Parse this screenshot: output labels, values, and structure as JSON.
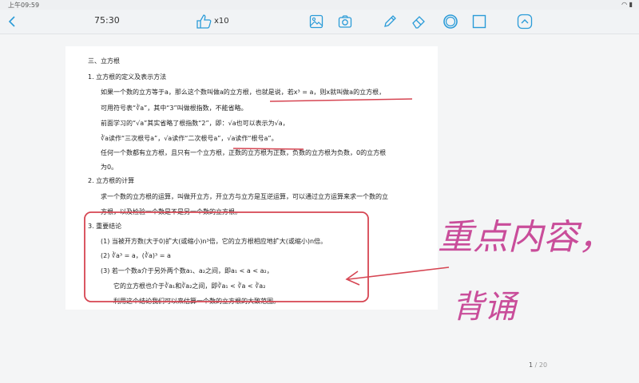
{
  "status": {
    "time": "上午09:59"
  },
  "toolbar": {
    "timer": "75:30",
    "likes": "x10",
    "icons": [
      "back-chevron-icon",
      "thumbs-up-icon",
      "image-icon",
      "camera-icon",
      "pen-icon",
      "eraser-icon",
      "circle-icon",
      "square-icon",
      "collapse-up-icon"
    ]
  },
  "doc": {
    "section_title": "三、立方根",
    "s1_title": "1.   立方根的定义及表示方法",
    "s1_l1": "如果一个数的立方等于a，那么这个数叫做a的立方根，也就是说，若x³ = a，则x就叫做a的立方根，",
    "s1_l2": "可用符号表“∛a”，其中“3”叫做根指数，不能省略。",
    "s1_l3": "前面学习的“√a”其实省略了根指数“2”，即：√a也可以表示为√a，",
    "s1_l4": "∛a读作“三次根号a”，√a读作“二次根号a”，√a读作“根号a”。",
    "s1_l5": "任何一个数都有立方根，且只有一个立方根，正数的立方根为正数，负数的立方根为负数，0的立方根",
    "s1_l6": "为0。",
    "s2_title": "2.   立方根的计算",
    "s2_l1": "求一个数的立方根的运算，叫做开立方，开立方与立方是互逆运算，可以通过立方运算来求一个数的立",
    "s2_l2": "方根，以及检验一个数是不是另一个数的立方根。",
    "s3_title": "3.   重要结论",
    "s3_l1": "(1)  当被开方数(大于0)扩大(或缩小)n³倍，它的立方根相应地扩大(或缩小)n倍。",
    "s3_l2": "(2)  ∛a³ = a，(∛a)³ = a",
    "s3_l3": "(3)  若一个数a介于另外两个数a₁、a₂之间，即a₁ < a < a₂，",
    "s3_l4": "它的立方根也介于∛a₁和∛a₂之间，即∛a₁ < ∛a < ∛a₂",
    "s3_l5": "利用这个结论我们可以来估算一个数的立方根的大致范围。"
  },
  "annotation": {
    "line1": "重点内容，",
    "line2": "背诵"
  },
  "pager": {
    "current": "1",
    "sep": " / ",
    "total": "20"
  },
  "colors": {
    "accent": "#2a9bd8",
    "ink": "#d64552",
    "handwriting": "#c94d9a"
  }
}
